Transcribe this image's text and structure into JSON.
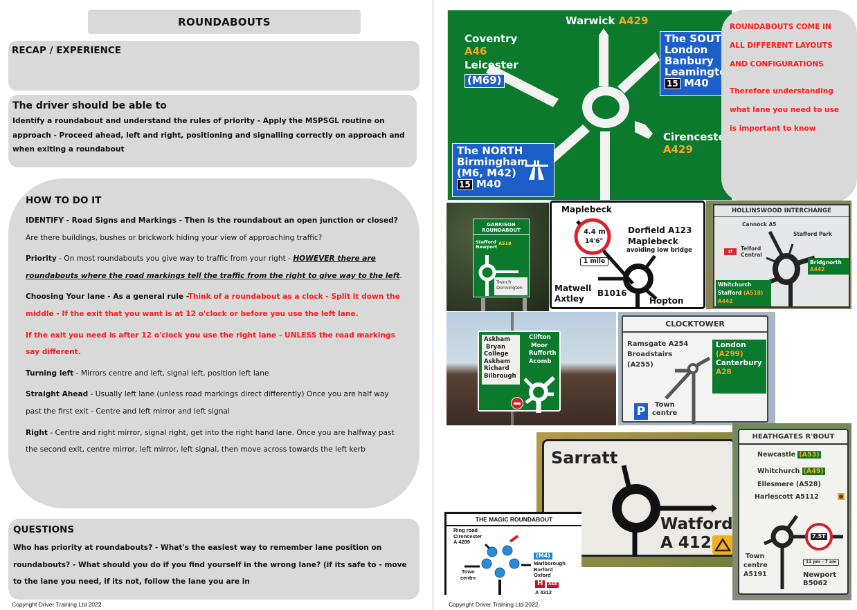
{
  "left_page": {
    "title": "ROUNDABOUTS",
    "recap": {
      "heading": "RECAP / EXPERIENCE"
    },
    "objectives": {
      "heading": "The driver should be able to",
      "text": "Identify a roundabout and understand the rules of priority - Apply the MSPSGL routine on approach - Proceed ahead, left and right, positioning and signalling correctly on approach and when exiting a roundabout"
    },
    "how_to": {
      "heading": "HOW TO DO IT",
      "identify_label": "IDENTIFY - Road Signs and Markings - Then is the roundabout an open junction or closed?",
      "identify_text": " Are there buildings, bushes or brickwork hiding your view of approaching traffic?",
      "priority_label": "Priority",
      "priority_text": " - On most roundabouts you give way to traffic from your right - ",
      "priority_emphasis": "HOWEVER there are roundabouts where the road markings tell the traffic from the right to give way to the left",
      "priority_end": ".",
      "lane_label": "Choosing Your lane - As a general rule -",
      "lane_red": "Think of a roundabout as a clock - Split it down the middle - If the exit that you want is at 12 o'clock or before you use the left lane.",
      "lane_red_2": "If the exit you need is after 12 o'clock you use the right lane - UNLESS the road markings say different.",
      "left_label": "Turning left",
      "left_text": " - Mirrors centre and left, signal left, position left lane",
      "ahead_label": "Straight Ahead",
      "ahead_text": " - Usually left lane (unless road markings direct differently) Once you are half way past the first exit - Centre and left mirror and left signal",
      "right_label": "Right",
      "right_text": " - Centre and right mirror, signal right, get into the right hand lane. Once you are halfway past the second exit, centre mirror, left mirror, left signal, then move across towards the left kerb"
    },
    "questions": {
      "heading": "QUESTIONS",
      "text": "Who has priority at roundabouts? - What's the easiest way to remember lane position on roundabouts? - What should you do if you find yourself in the wrong lane? (if its safe to - move to the lane you need, if its not, follow the lane you are in"
    },
    "copyright": "Copyright Driver Training Ltd 2022"
  },
  "right_page": {
    "callout": {
      "line1": "ROUNDABOUTS COME IN",
      "line2": "ALL DIFFERENT LAYOUTS",
      "line3": "AND CONFIGURATIONS",
      "line4": "Therefore understanding",
      "line5": "what lane you need to use",
      "line6": "is important to know"
    },
    "sign_warwick": {
      "top_place": "Warwick",
      "top_road": "A429",
      "coventry": "Coventry",
      "coventry_road": "A46",
      "leicester": "Leicester",
      "leicester_road": "(M69)",
      "south_1": "The SOUTH",
      "south_2": "London",
      "south_3": "Banbury",
      "south_4": "Leamington",
      "south_junction": "15",
      "south_road": "M40",
      "cirencester": "Cirencester",
      "cirencester_road": "A429",
      "north_1": "The NORTH",
      "north_2": "Birmingham",
      "north_3": "(M6, M42)",
      "north_junction": "15",
      "north_road": "M40"
    },
    "sign_garrison": {
      "header_1": "GARRISON",
      "header_2": "ROUNDABOUT",
      "place_1": "Stafford",
      "place_2": "Newport",
      "road": "A518",
      "local_1": "Trench",
      "local_2": "Donnington"
    },
    "sign_maplebeck": {
      "top": "Maplebeck",
      "height_m": "4.4 m",
      "height_ft": "14'6\"",
      "distance": "1 mile",
      "right_1": "Dorfield A123",
      "right_2": "Maplebeck",
      "right_3": "avoiding low bridge",
      "left_1": "Matwell",
      "left_2": "Axtley",
      "left_road": "B1016",
      "bottom": "Hopton"
    },
    "sign_hollinswood": {
      "header": "HOLLINSWOOD INTERCHANGE",
      "top": "Cannock A5",
      "top_right": "Stafford Park",
      "left_1": "Telford",
      "left_2": "Central",
      "right_place": "Bridgnorth",
      "right_road": "A442",
      "bottom_1": "Whitchurch",
      "bottom_2": "Stafford",
      "bottom_2_road": "(A518)",
      "bottom_3": "A442"
    },
    "sign_askham": {
      "left_1": "Askham",
      "left_2": "Bryan",
      "left_3": "College",
      "left_4": "Askham",
      "left_5": "Richard",
      "left_6": "Bilbrough",
      "right_1": "Clifton",
      "right_2": "Moor",
      "right_3": "Rufforth",
      "right_4": "Acomb"
    },
    "sign_clocktower": {
      "header": "CLOCKTOWER",
      "left_1": "Ramsgate A254",
      "left_2": "Broadstairs",
      "left_3": "(A255)",
      "right_1": "London",
      "right_2": "(A299)",
      "right_3": "Canterbury",
      "right_4": "A28",
      "parking": "P",
      "bottom_1": "Town",
      "bottom_2": "centre"
    },
    "sign_sarratt": {
      "top": "Sarratt",
      "right_place": "Watford",
      "right_road": "A 412"
    },
    "sign_heathgates": {
      "header": "HEATHGATES R'BOUT",
      "line_1": "Newcastle",
      "line_1_road": "(A53)",
      "line_2": "Whitchurch",
      "line_2_road": "(A49)",
      "line_3": "Ellesmere (A528)",
      "line_4": "Harlescott A5112",
      "weight": "7.5T",
      "left_1": "Town",
      "left_2": "centre",
      "left_3": "A5191",
      "time": "11 pm - 7 am",
      "bottom_1": "Newport",
      "bottom_2": "B5062"
    },
    "sign_magic": {
      "header": "THE MAGIC ROUNDABOUT",
      "top_1": "Ring road",
      "top_2": "Cirencester",
      "top_3": "A 4289",
      "right_road": "(M4)",
      "right_1": "Marlborough",
      "right_2": "Burford",
      "right_3": "Oxford",
      "hospital": "H",
      "hospital_label": "A&E",
      "bottom": "A 4312",
      "left_1": "Town",
      "left_2": "centre"
    },
    "copyright": "Copyright Driver Training Ltd 2022"
  }
}
